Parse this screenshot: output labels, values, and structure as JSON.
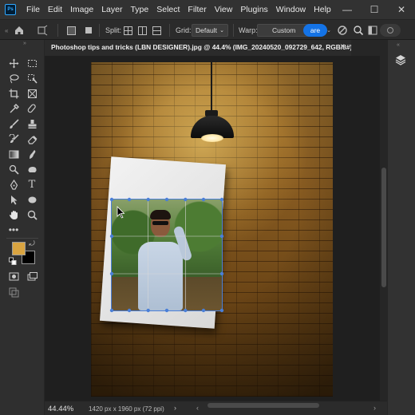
{
  "app": {
    "logo_text": "Ps"
  },
  "menu": [
    "File",
    "Edit",
    "Image",
    "Layer",
    "Type",
    "Select",
    "Filter",
    "View",
    "Plugins",
    "Window",
    "Help"
  ],
  "window_controls": {
    "minimize": "—",
    "maximize": "☐",
    "close": "✕"
  },
  "options_bar": {
    "split_label": "Split:",
    "grid_label": "Grid:",
    "grid_value": "Default",
    "warp_label": "Warp:",
    "warp_value": "Custom",
    "clipped_button_text": "are"
  },
  "document": {
    "tab_title": "Photoshop tips and tricks (LBN DESIGNER).jpg @ 44.4% (IMG_20240520_092729_642, RGB/8#) *",
    "close_glyph": "×"
  },
  "colors": {
    "foreground": "#d9a441",
    "background": "#000000",
    "accent": "#1473e6",
    "handle": "#4a7fd8"
  },
  "status": {
    "zoom": "44.44%",
    "doc_info": "1420 px x 1960 px (72 ppi)",
    "arrow": "›",
    "scroll_left": "‹",
    "scroll_right": "›"
  },
  "icons": [
    "home-icon",
    "transform-mode-icon",
    "split-icons",
    "grid-select",
    "warp-select",
    "confirm-icon",
    "cancel-icon",
    "search-icon",
    "workspace-icon",
    "share-icon",
    "layers-icon"
  ]
}
